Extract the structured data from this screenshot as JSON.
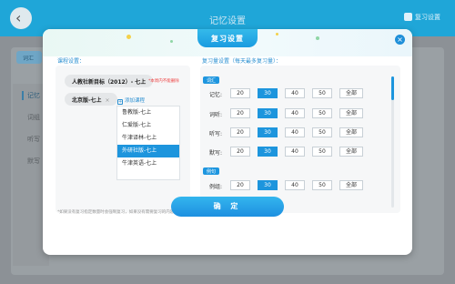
{
  "background": {
    "title": "记忆设置",
    "right_link": "复习设置",
    "tab": "词汇",
    "side_items": [
      "记忆",
      "词组",
      "听写",
      "默写"
    ]
  },
  "modal": {
    "title": "复习设置",
    "close_icon": "close-icon",
    "left": {
      "section_label": "课程设置：",
      "chips": [
        {
          "label": "人教社新目标（2012）- 七上"
        },
        {
          "label": "北京版-七上",
          "remove": "×"
        }
      ],
      "chip_note": "*本周内不能删除",
      "add_course": "添加课程",
      "options": [
        "鲁教版-七上",
        "仁爱版-七上",
        "牛津译林-七上",
        "外研社版-七上",
        "牛津英语-七上"
      ],
      "selected_index": 3
    },
    "right": {
      "section_label": "复习量设置（每天最多复习量）：",
      "groups": [
        {
          "tag": "词汇",
          "rows": [
            {
              "label": "记忆:",
              "options": [
                "20",
                "30",
                "40",
                "50",
                "全部"
              ],
              "selected": 1
            },
            {
              "label": "词听:",
              "options": [
                "20",
                "30",
                "40",
                "50",
                "全部"
              ],
              "selected": 1
            },
            {
              "label": "听写:",
              "options": [
                "20",
                "30",
                "40",
                "50",
                "全部"
              ],
              "selected": 1
            },
            {
              "label": "默写:",
              "options": [
                "20",
                "30",
                "40",
                "50",
                "全部"
              ],
              "selected": 1
            }
          ]
        },
        {
          "tag": "例句",
          "rows": [
            {
              "label": "例组:",
              "options": [
                "20",
                "30",
                "40",
                "50",
                "全部"
              ],
              "selected": 1
            }
          ]
        }
      ]
    },
    "footnote": "*如果没有复习指定数量时会强制复习，如果没有需要复习的内容不强制复习。",
    "confirm": "确 定"
  },
  "colors": {
    "accent": "#1d95dd",
    "header_bar": "#1fa6d8"
  }
}
